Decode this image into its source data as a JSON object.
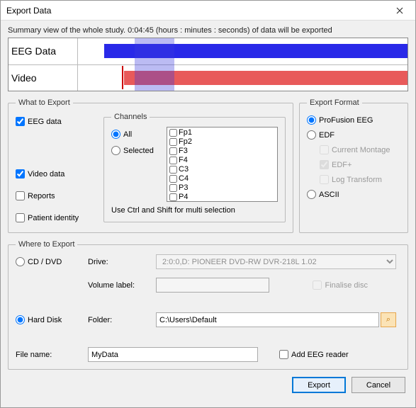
{
  "window": {
    "title": "Export Data"
  },
  "summary": "Summary view of the whole study.  0:04:45 (hours : minutes : seconds) of data will be exported",
  "timeline": {
    "rows": [
      "EEG Data",
      "Video"
    ]
  },
  "what": {
    "legend": "What to Export",
    "eeg_data": "EEG data",
    "video_data": "Video data",
    "reports": "Reports",
    "patient_identity": "Patient identity"
  },
  "channels": {
    "legend": "Channels",
    "all": "All",
    "selected": "Selected",
    "items": [
      "Fp1",
      "Fp2",
      "F3",
      "F4",
      "C3",
      "C4",
      "P3",
      "P4"
    ],
    "hint": "Use Ctrl and Shift for multi selection"
  },
  "format": {
    "legend": "Export Format",
    "profusion": "ProFusion EEG",
    "edf": "EDF",
    "current_montage": "Current Montage",
    "edf_plus": "EDF+",
    "log_transform": "Log Transform",
    "ascii": "ASCII"
  },
  "where": {
    "legend": "Where to Export",
    "cd_dvd": "CD / DVD",
    "drive_label": "Drive:",
    "drive_value": "2:0:0,D: PIONEER  DVD-RW  DVR-218L 1.02",
    "volume_label": "Volume label:",
    "finalise": "Finalise disc",
    "hard_disk": "Hard Disk",
    "folder_label": "Folder:",
    "folder_value": "C:\\Users\\Default",
    "file_name_label": "File name:",
    "file_name_value": "MyData",
    "add_reader": "Add EEG reader"
  },
  "buttons": {
    "export": "Export",
    "cancel": "Cancel"
  }
}
